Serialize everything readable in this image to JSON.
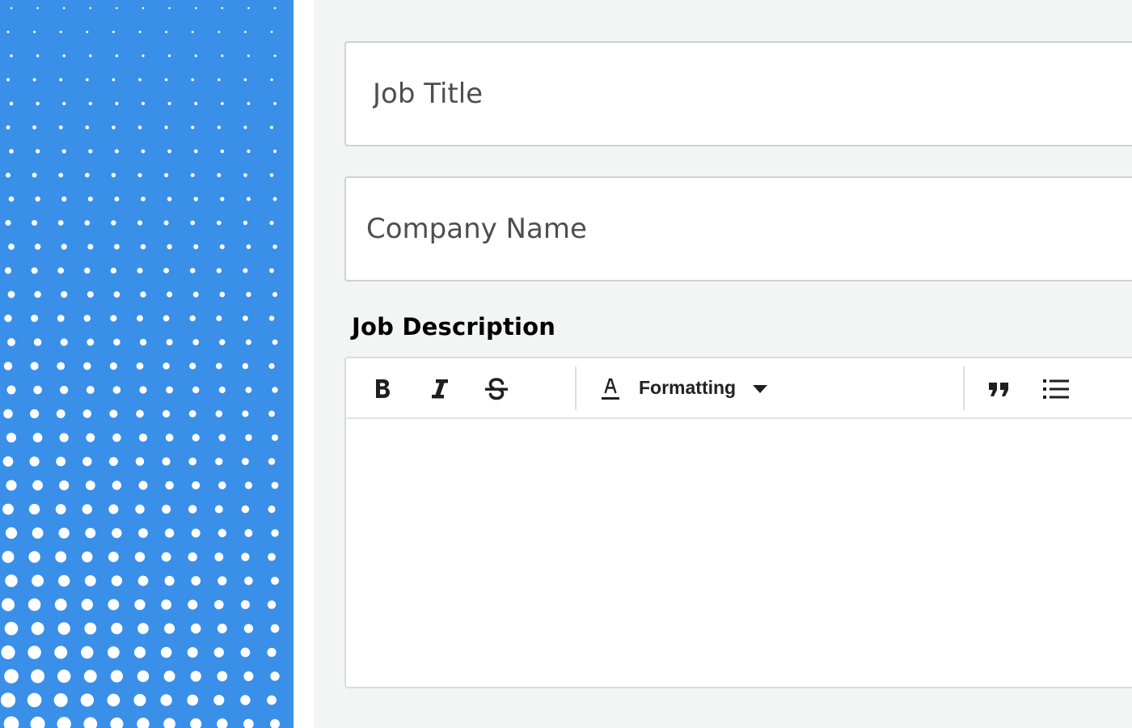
{
  "colors": {
    "side_panel": "#3a8fe8",
    "form_background": "#f3f5f4",
    "field_border": "#cfd2d2",
    "label_text": "#000000",
    "toolbar_icon": "#1f1f1f"
  },
  "form": {
    "job_title": {
      "value": "",
      "placeholder": "Job Title"
    },
    "company_name": {
      "value": "",
      "placeholder": "Company Name"
    },
    "description_label": "Job Description"
  },
  "editor": {
    "toolbar": {
      "bold_icon": "bold-icon",
      "italic_icon": "italic-icon",
      "strikethrough_icon": "strikethrough-icon",
      "text_color_icon": "text-color-icon",
      "formatting_label": "Formatting",
      "formatting_dropdown_icon": "caret-down-icon",
      "quote_icon": "quote-icon",
      "list_icon": "bullet-list-icon"
    },
    "content": ""
  }
}
